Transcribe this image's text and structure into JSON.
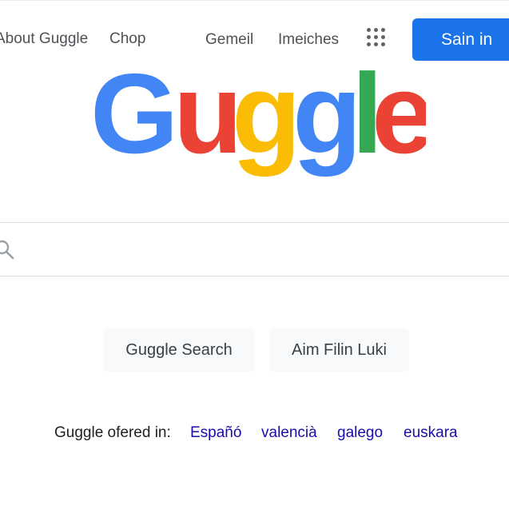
{
  "header": {
    "about_label": "About Guggle",
    "shop_label": "Chop",
    "gmail_label": "Gemeil",
    "images_label": "Imeiches",
    "apps_icon": "grid-apps-icon",
    "signin_label": "Sain in"
  },
  "logo": {
    "letters": [
      {
        "char": "G",
        "color": "#4285F4"
      },
      {
        "char": "u",
        "color": "#EA4335"
      },
      {
        "char": "g",
        "color": "#FBBC05"
      },
      {
        "char": "g",
        "color": "#4285F4"
      },
      {
        "char": "l",
        "color": "#34A853"
      },
      {
        "char": "e",
        "color": "#EA4335"
      }
    ]
  },
  "search": {
    "icon": "search-icon",
    "value": "",
    "placeholder": ""
  },
  "buttons": {
    "search_label": "Guggle Search",
    "lucky_label": "Aim Filin Luki"
  },
  "languages": {
    "label": "Guggle ofered in:",
    "items": [
      "Españó",
      "valencià",
      "galego",
      "euskara"
    ]
  },
  "colors": {
    "accent": "#1a73e8",
    "link": "#1a0dab"
  }
}
